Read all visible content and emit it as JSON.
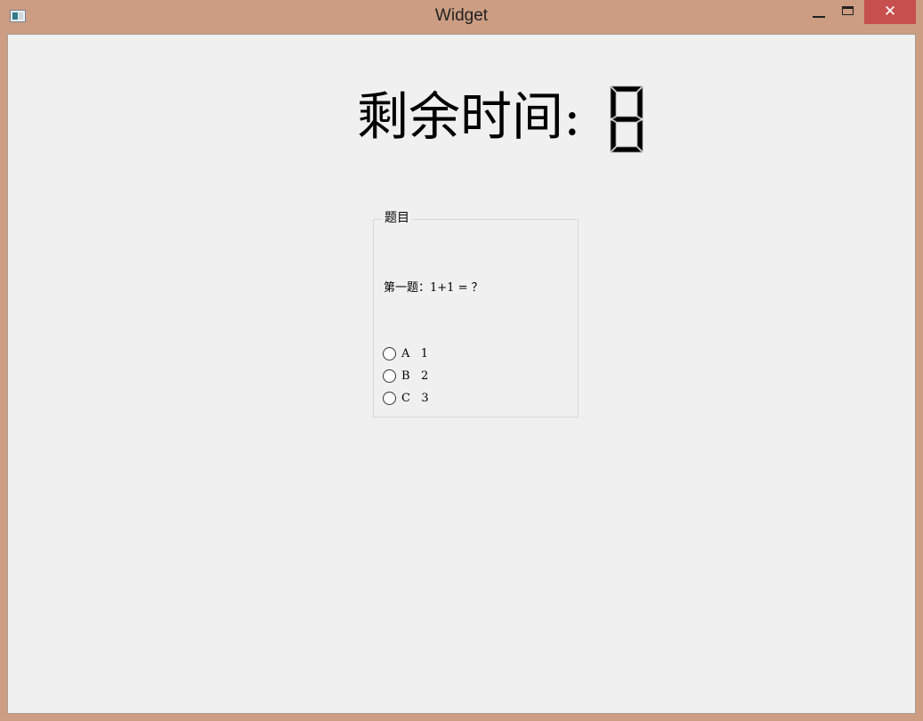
{
  "window": {
    "title": "Widget",
    "close_glyph": "✕"
  },
  "timer": {
    "label": "剩余时间:",
    "value": 8
  },
  "quiz": {
    "group_title": "题目",
    "question": "第一题：1+1 = ？",
    "options": [
      {
        "text": "A   1",
        "checked": false
      },
      {
        "text": "B   2",
        "checked": false
      },
      {
        "text": "C   3",
        "checked": false
      }
    ]
  },
  "colors": {
    "frame": "#cc9d82",
    "close_button": "#c7504f",
    "client_bg": "#f0f0f0"
  }
}
